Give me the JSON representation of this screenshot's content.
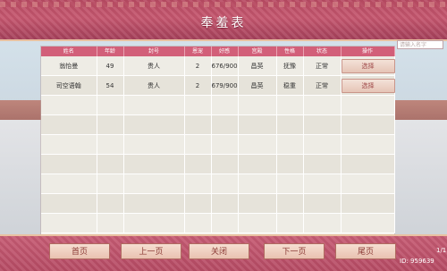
{
  "title": "奉羞表",
  "search": {
    "placeholder": "请输入名字"
  },
  "table": {
    "headers": [
      "姓名",
      "年龄",
      "封号",
      "恩宠",
      "好感",
      "宫殿",
      "性格",
      "状态",
      "操作"
    ],
    "rows": [
      [
        "翁怡曼",
        "49",
        "贵人",
        "2",
        "676/900",
        "昌英",
        "抚豫",
        "正常",
        "选择"
      ],
      [
        "司空语翰",
        "54",
        "贵人",
        "2",
        "679/900",
        "昌英",
        "稳重",
        "正常",
        "选择"
      ]
    ]
  },
  "footer": {
    "first": "首页",
    "prev": "上一页",
    "close": "关闭",
    "next": "下一页",
    "last": "尾页",
    "page": "1/1",
    "id": "ID: 959639"
  }
}
